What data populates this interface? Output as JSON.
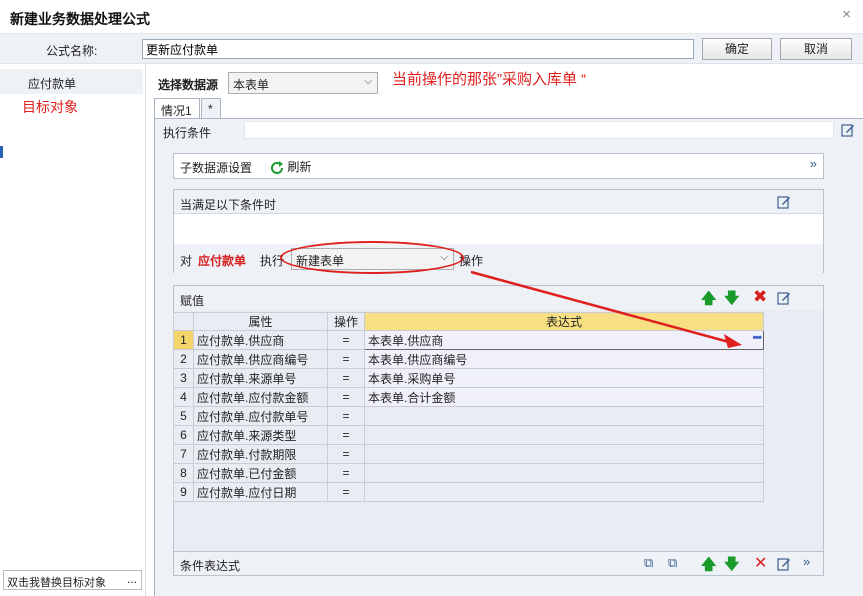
{
  "window": {
    "title": "新建业务数据处理公式",
    "close_label": "×"
  },
  "formula": {
    "name_label": "公式名称:",
    "name_value": "更新应付款单",
    "ok_label": "确定",
    "cancel_label": "取消"
  },
  "left": {
    "items": [
      {
        "label": "应付款单"
      }
    ],
    "annotation": "目标对象",
    "bottom_text": "双击我替换目标对象",
    "bottom_more": "..."
  },
  "source": {
    "label": "选择数据源",
    "value": "本表单",
    "annotation": "当前操作的那张”采购入库单 “"
  },
  "tabs": [
    {
      "label": "情况1"
    },
    {
      "label": "*"
    }
  ],
  "exec_condition": {
    "label": "执行条件",
    "value": ""
  },
  "subsource": {
    "label": "子数据源设置",
    "refresh_label": "刷新"
  },
  "condition": {
    "title": "当满足以下条件时",
    "prefix": "对",
    "target": "应付款单",
    "exec": "执行",
    "action_value": "新建表单",
    "op_label": "操作"
  },
  "assign": {
    "title": "赋值",
    "columns": [
      "属性",
      "操作",
      "表达式"
    ],
    "rows": [
      {
        "n": "1",
        "prop": "应付款单.供应商",
        "op": "=",
        "expr": "本表单.供应商"
      },
      {
        "n": "2",
        "prop": "应付款单.供应商编号",
        "op": "=",
        "expr": "本表单.供应商编号"
      },
      {
        "n": "3",
        "prop": "应付款单.来源单号",
        "op": "=",
        "expr": "本表单.采购单号"
      },
      {
        "n": "4",
        "prop": "应付款单.应付款金额",
        "op": "=",
        "expr": "本表单.合计金额"
      },
      {
        "n": "5",
        "prop": "应付款单.应付款单号",
        "op": "=",
        "expr": ""
      },
      {
        "n": "6",
        "prop": "应付款单.来源类型",
        "op": "=",
        "expr": ""
      },
      {
        "n": "7",
        "prop": "应付款单.付款期限",
        "op": "=",
        "expr": ""
      },
      {
        "n": "8",
        "prop": "应付款单.已付金额",
        "op": "=",
        "expr": ""
      },
      {
        "n": "9",
        "prop": "应付款单.应付日期",
        "op": "=",
        "expr": ""
      }
    ],
    "ellipsis": "•••"
  },
  "cond_expr": {
    "label": "条件表达式"
  },
  "colors": {
    "annotation": "#e0201e",
    "accent_green": "#1a9a2a",
    "delete_red": "#d81e1e"
  }
}
